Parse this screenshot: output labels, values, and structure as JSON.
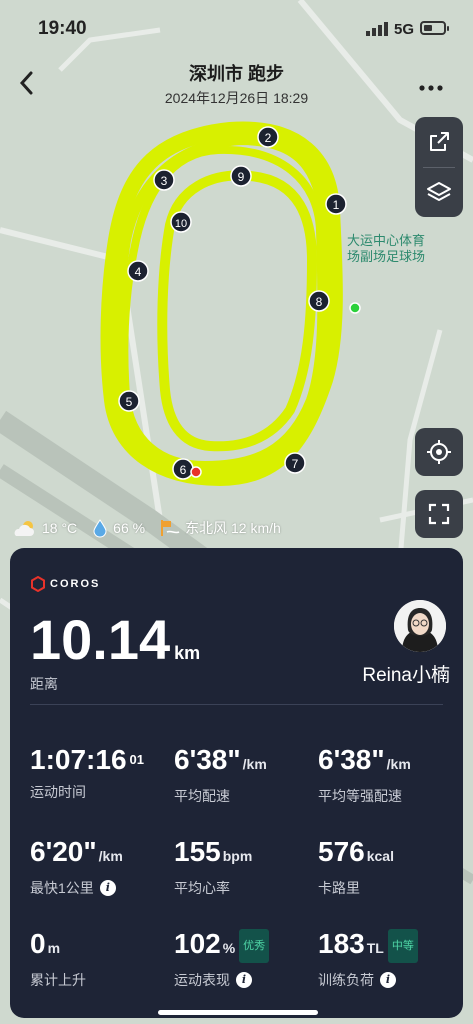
{
  "status_bar": {
    "time": "19:40",
    "network": "5G"
  },
  "header": {
    "title": "深圳市 跑步",
    "subtitle": "2024年12月26日 18:29"
  },
  "map": {
    "venue_label_line1": "大运中心体育",
    "venue_label_line2": "场副场足球场",
    "route_color": "#d8f000",
    "markers": [
      "1",
      "2",
      "3",
      "4",
      "5",
      "6",
      "7",
      "8",
      "9",
      "10"
    ]
  },
  "weather": {
    "temperature": "18 °C",
    "humidity": "66 %",
    "wind": "东北风 12 km/h"
  },
  "panel": {
    "brand": "COROS",
    "distance_value": "10.14",
    "distance_unit": "km",
    "distance_label": "距离",
    "user_name": "Reina小楠",
    "metrics": [
      {
        "value": "1:07:16",
        "extra": "01",
        "unit": "",
        "label": "运动时间"
      },
      {
        "value": "6'38\"",
        "unit": "/km",
        "label": "平均配速"
      },
      {
        "value": "6'38\"",
        "unit": "/km",
        "label": "平均等强配速"
      },
      {
        "value": "6'20\"",
        "unit": "/km",
        "label": "最快1公里"
      },
      {
        "value": "155",
        "unit": "bpm",
        "label": "平均心率"
      },
      {
        "value": "576",
        "unit": "kcal",
        "label": "卡路里"
      },
      {
        "value": "0",
        "unit": "m",
        "label": "累计上升"
      },
      {
        "value": "102",
        "unit": "%",
        "badge": "优秀",
        "label": "运动表现"
      },
      {
        "value": "183",
        "unit": "TL",
        "badge": "中等",
        "label": "训练负荷"
      }
    ]
  },
  "colors": {
    "panel_bg": "#1e2436",
    "accent_badge": "#4fd6a6"
  }
}
